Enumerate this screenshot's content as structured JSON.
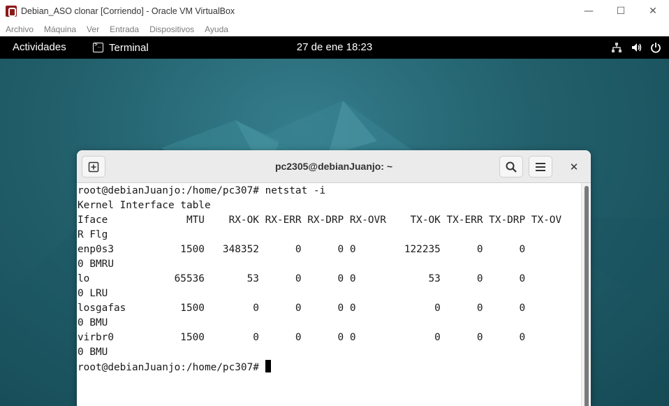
{
  "vbox": {
    "title": "Debian_ASO clonar [Corriendo] - Oracle VM VirtualBox",
    "menu": [
      "Archivo",
      "Máquina",
      "Ver",
      "Entrada",
      "Dispositivos",
      "Ayuda"
    ],
    "minimize_glyph": "—",
    "maximize_glyph": "☐",
    "close_glyph": "✕"
  },
  "gnome_panel": {
    "activities": "Actividades",
    "app_name": "Terminal",
    "clock": "27 de ene  18:23",
    "status_icons": [
      "network-wired-icon",
      "volume-icon",
      "power-icon"
    ]
  },
  "terminal": {
    "title": "pc2305@debianJuanjo: ~",
    "close_glyph": "✕",
    "lines": [
      "root@debianJuanjo:/home/pc307# netstat -i",
      "Kernel Interface table",
      "Iface             MTU    RX-OK RX-ERR RX-DRP RX-OVR    TX-OK TX-ERR TX-DRP TX-OV",
      "R Flg",
      "enp0s3           1500   348352      0      0 0        122235      0      0",
      "0 BMRU",
      "lo              65536       53      0      0 0            53      0      0",
      "0 LRU",
      "losgafas         1500        0      0      0 0             0      0      0",
      "0 BMU",
      "virbr0           1500        0      0      0 0             0      0      0",
      "0 BMU",
      "root@debianJuanjo:/home/pc307# "
    ]
  },
  "colors": {
    "desktop_accent": "#22606c",
    "panel_bg": "#000000",
    "terminal_bg": "#ffffff"
  }
}
